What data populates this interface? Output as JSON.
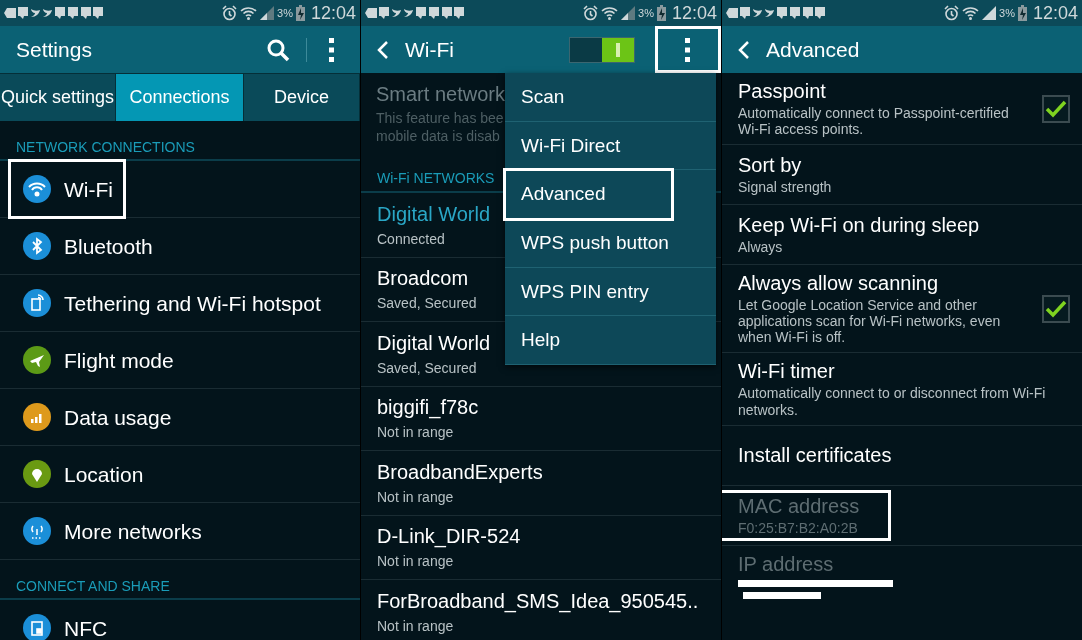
{
  "settings_screen": {
    "status_bar": {
      "battery": "3%",
      "time": "12:04"
    },
    "title": "Settings",
    "tabs": [
      {
        "label": "Quick settings",
        "selected": false
      },
      {
        "label": "Connections",
        "selected": true
      },
      {
        "label": "Device",
        "selected": false
      }
    ],
    "sections": [
      {
        "header": "NETWORK CONNECTIONS",
        "items": [
          {
            "label": "Wi-Fi",
            "color": "#1b8fd8",
            "highlighted": true
          },
          {
            "label": "Bluetooth",
            "color": "#1b8fd8",
            "highlighted": false
          },
          {
            "label": "Tethering and Wi-Fi hotspot",
            "color": "#1b8fd8",
            "highlighted": false
          },
          {
            "label": "Flight mode",
            "color": "#5c9a16",
            "highlighted": false
          },
          {
            "label": "Data usage",
            "color": "#de9a1c",
            "highlighted": false
          },
          {
            "label": "Location",
            "color": "#6a9a12",
            "highlighted": false
          },
          {
            "label": "More networks",
            "color": "#1b8fd8",
            "highlighted": false
          }
        ]
      },
      {
        "header": "CONNECT AND SHARE",
        "items": [
          {
            "label": "NFC",
            "color": "#1b8fd8",
            "highlighted": false
          }
        ]
      }
    ]
  },
  "wifi_screen": {
    "status_bar": {
      "battery": "3%",
      "time": "12:04"
    },
    "title": "Wi-Fi",
    "switch_on": true,
    "menu_button_highlighted": true,
    "smart_network": {
      "title": "Smart network",
      "lines": [
        "This feature has bee",
        "mobile data is disab"
      ]
    },
    "networks_header": "Wi-Fi NETWORKS",
    "networks": [
      {
        "name": "Digital World",
        "status": "Connected",
        "connected": true
      },
      {
        "name": "Broadcom",
        "status": "Saved, Secured",
        "connected": false
      },
      {
        "name": "Digital World",
        "status": "Saved, Secured",
        "connected": false
      },
      {
        "name": "biggifi_f78c",
        "status": "Not in range",
        "connected": false
      },
      {
        "name": "BroadbandExperts",
        "status": "Not in range",
        "connected": false
      },
      {
        "name": "D-Link_DIR-524",
        "status": "Not in range",
        "connected": false
      },
      {
        "name": "ForBroadband_SMS_Idea_950545..",
        "status": "Not in range",
        "connected": false
      }
    ],
    "menu": [
      {
        "label": "Scan",
        "highlighted": false
      },
      {
        "label": "Wi-Fi Direct",
        "highlighted": false
      },
      {
        "label": "Advanced",
        "highlighted": true
      },
      {
        "label": "WPS push button",
        "highlighted": false
      },
      {
        "label": "WPS PIN entry",
        "highlighted": false
      },
      {
        "label": "Help",
        "highlighted": false
      }
    ]
  },
  "advanced_screen": {
    "status_bar": {
      "battery": "3%",
      "time": "12:04"
    },
    "title": "Advanced",
    "items": [
      {
        "kind": "checkbox",
        "title": "Passpoint",
        "summary": "Automatically connect to Passpoint-certified Wi-Fi access points.",
        "checked": true
      },
      {
        "kind": "text",
        "title": "Sort by",
        "summary": "Signal strength"
      },
      {
        "kind": "text",
        "title": "Keep Wi-Fi on during sleep",
        "summary": "Always"
      },
      {
        "kind": "checkbox",
        "title": "Always allow scanning",
        "summary": "Let Google Location Service and other applications scan for Wi-Fi networks, even when Wi-Fi is off.",
        "checked": true
      },
      {
        "kind": "text",
        "title": "Wi-Fi timer",
        "summary": "Automatically connect to or disconnect from Wi-Fi networks."
      },
      {
        "kind": "text",
        "title": "Install certificates"
      },
      {
        "kind": "info",
        "title": "MAC address",
        "summary": "F0:25:B7:B2:A0:2B",
        "highlighted": true
      },
      {
        "kind": "redacted",
        "title": "IP address"
      }
    ]
  }
}
